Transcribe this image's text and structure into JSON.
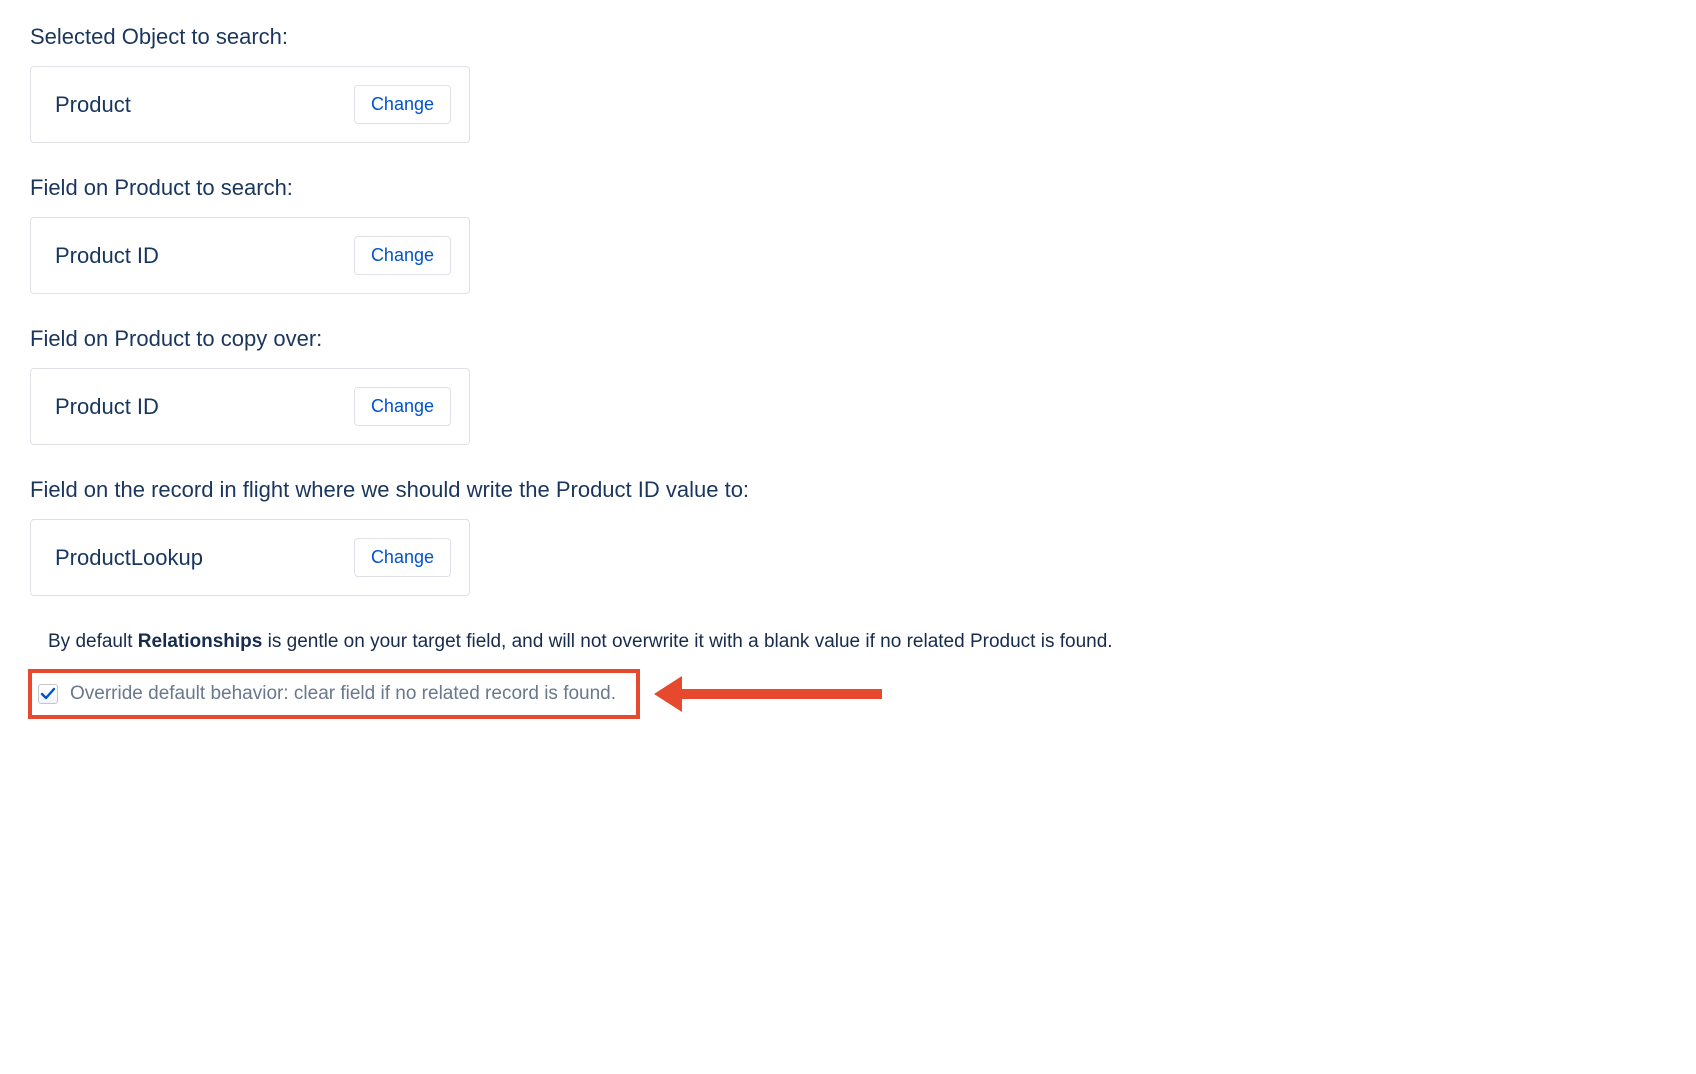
{
  "sections": {
    "object_to_search": {
      "label": "Selected Object to search:",
      "value": "Product",
      "change": "Change"
    },
    "field_to_search": {
      "label": "Field on Product to search:",
      "value": "Product ID",
      "change": "Change"
    },
    "field_to_copy": {
      "label": "Field on Product to copy over:",
      "value": "Product ID",
      "change": "Change"
    },
    "field_to_write": {
      "label": "Field on the record in flight where we should write the Product ID value to:",
      "value": "ProductLookup",
      "change": "Change"
    }
  },
  "description": {
    "prefix": "By default ",
    "strong": "Relationships",
    "suffix": " is gentle on your target field, and will not overwrite it with a blank value if no related Product is found."
  },
  "override": {
    "checked": true,
    "label": "Override default behavior: clear field if no related record is found."
  }
}
